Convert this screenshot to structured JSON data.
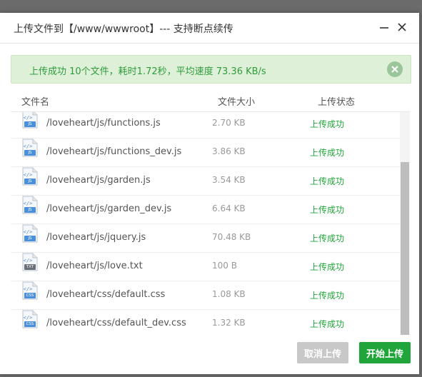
{
  "dialog": {
    "title": "上传文件到【/www/wwwroot】--- 支持断点续传"
  },
  "alert": {
    "message": "上传成功 10个文件，耗时1.72秒，平均速度 73.36 KB/s"
  },
  "columns": {
    "name": "文件名",
    "size": "文件大小",
    "status": "上传状态"
  },
  "files": [
    {
      "icon": "js-file-icon",
      "type_label": "JS",
      "name": "/loveheart/js/functions.js",
      "size": "2.70 KB",
      "status": "上传成功"
    },
    {
      "icon": "js-file-icon",
      "type_label": "JS",
      "name": "/loveheart/js/functions_dev.js",
      "size": "3.86 KB",
      "status": "上传成功"
    },
    {
      "icon": "js-file-icon",
      "type_label": "JS",
      "name": "/loveheart/js/garden.js",
      "size": "3.54 KB",
      "status": "上传成功"
    },
    {
      "icon": "js-file-icon",
      "type_label": "JS",
      "name": "/loveheart/js/garden_dev.js",
      "size": "6.64 KB",
      "status": "上传成功"
    },
    {
      "icon": "js-file-icon",
      "type_label": "JS",
      "name": "/loveheart/js/jquery.js",
      "size": "70.48 KB",
      "status": "上传成功"
    },
    {
      "icon": "txt-file-icon",
      "type_label": "TXT",
      "name": "/loveheart/js/love.txt",
      "size": "100 B",
      "status": "上传成功"
    },
    {
      "icon": "css-file-icon",
      "type_label": "CSS",
      "name": "/loveheart/css/default.css",
      "size": "1.08 KB",
      "status": "上传成功"
    },
    {
      "icon": "css-file-icon",
      "type_label": "CSS",
      "name": "/loveheart/css/default_dev.css",
      "size": "1.32 KB",
      "status": "上传成功"
    }
  ],
  "footer": {
    "cancel_label": "取消上传",
    "start_label": "开始上传"
  },
  "colors": {
    "accent": "#20a53a",
    "alert_bg": "#dff0d8",
    "disabled": "#c8c8c8",
    "js_badge": "#4a90d9",
    "txt_badge": "#6a6f78",
    "css_badge": "#4a90d9"
  }
}
